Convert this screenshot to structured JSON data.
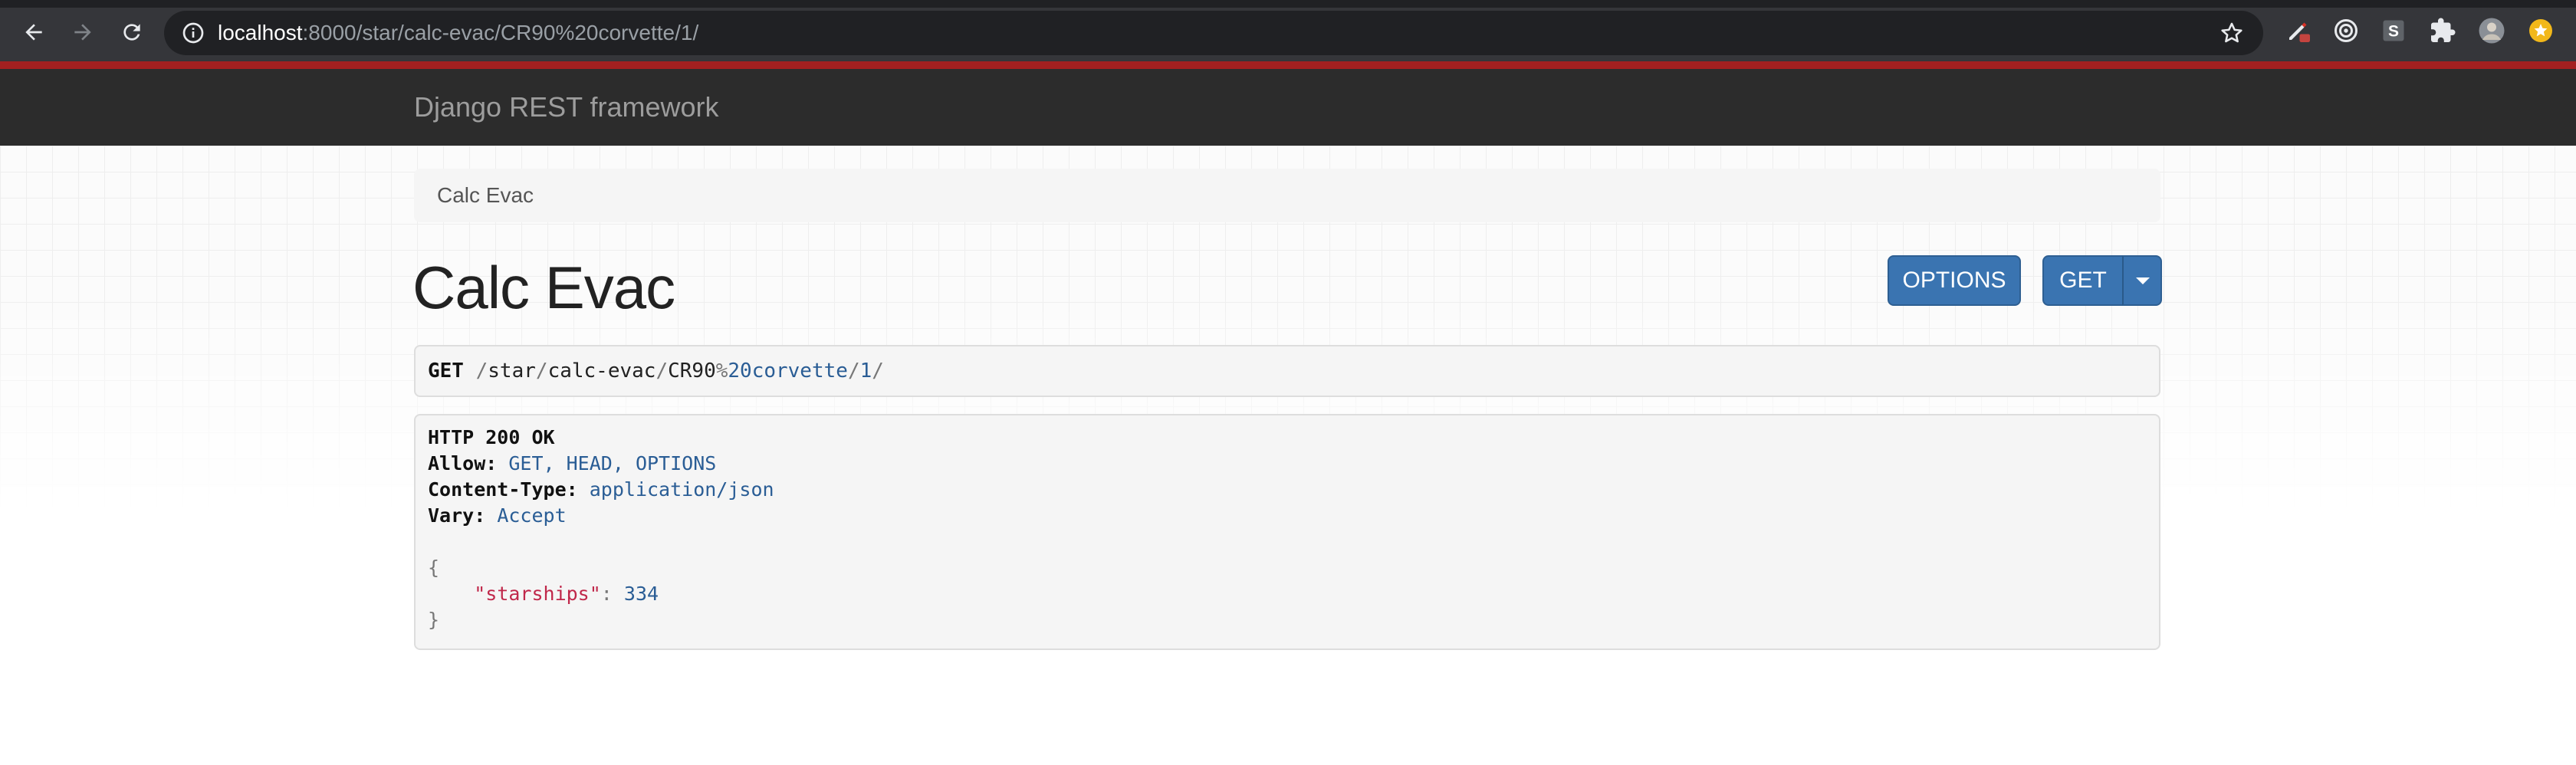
{
  "browser": {
    "url_host": "localhost",
    "url_path": ":8000/star/calc-evac/CR90%20corvette/1/",
    "icons": [
      "back-icon",
      "forward-icon",
      "reload-icon",
      "info-icon",
      "star-icon",
      "pen-extension-icon",
      "target-extension-icon",
      "s-extension-icon",
      "puzzle-extension-icon",
      "avatar",
      "coin-extension-icon"
    ],
    "colors": {
      "chrome": "#35363a",
      "omnibox": "#202124",
      "accent_line": "#a32020"
    }
  },
  "navbar": {
    "brand": "Django REST framework"
  },
  "breadcrumb": {
    "label": "Calc Evac"
  },
  "page": {
    "title": "Calc Evac"
  },
  "buttons": {
    "options": "OPTIONS",
    "get": "GET"
  },
  "request": {
    "method": "GET",
    "path_parts": [
      "/",
      "star",
      "/",
      "calc-evac",
      "/",
      "CR90",
      "%",
      "20corvette",
      "/",
      "1",
      "/"
    ]
  },
  "response": {
    "status": "HTTP 200 OK",
    "headers": [
      {
        "name": "Allow:",
        "value": "GET, HEAD, OPTIONS"
      },
      {
        "name": "Content-Type:",
        "value": "application/json"
      },
      {
        "name": "Vary:",
        "value": "Accept"
      }
    ],
    "body": {
      "open": "{",
      "key": "\"starships\"",
      "colon": ":",
      "value": "334",
      "close": "}"
    }
  },
  "colors": {
    "primary_button": "#3a74b1",
    "navbar": "#2c2c2c",
    "json_string": "#c0274a",
    "json_literal": "#2a5d95"
  }
}
